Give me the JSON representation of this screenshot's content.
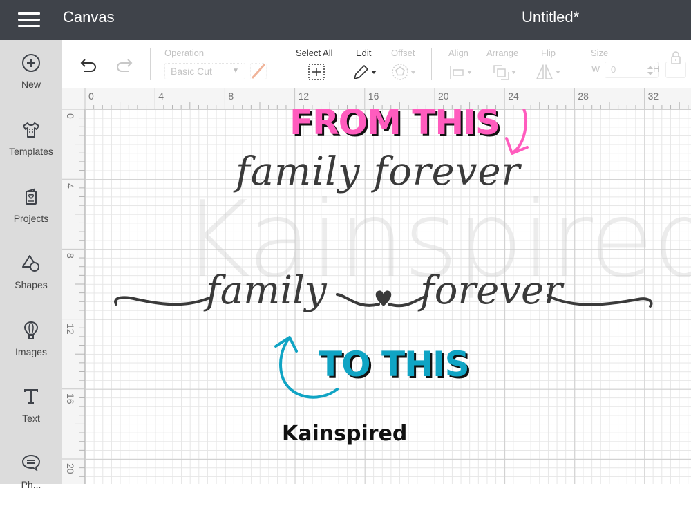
{
  "header": {
    "app_title": "Canvas",
    "document_title": "Untitled*"
  },
  "sidebar": {
    "items": [
      {
        "label": "New",
        "icon": "plus-circle-icon"
      },
      {
        "label": "Templates",
        "icon": "tshirt-icon"
      },
      {
        "label": "Projects",
        "icon": "projects-card-icon"
      },
      {
        "label": "Shapes",
        "icon": "shapes-icon"
      },
      {
        "label": "Images",
        "icon": "hot-air-balloon-icon"
      },
      {
        "label": "Text",
        "icon": "text-t-icon"
      },
      {
        "label": "Ph...",
        "icon": "speech-bubble-icon"
      }
    ]
  },
  "toolbar": {
    "operation_label": "Operation",
    "operation_value": "Basic Cut",
    "select_all_label": "Select All",
    "edit_label": "Edit",
    "offset_label": "Offset",
    "align_label": "Align",
    "arrange_label": "Arrange",
    "flip_label": "Flip",
    "size_label": "Size",
    "width_label": "W",
    "width_value": "0",
    "height_label": "H",
    "linetype_color": "#f0b49a"
  },
  "ruler": {
    "top_ticks": [
      "0",
      "4",
      "8",
      "12",
      "16",
      "20",
      "24",
      "28",
      "32"
    ],
    "left_ticks": [
      "0",
      "4",
      "8",
      "12",
      "16",
      "20"
    ]
  },
  "canvas": {
    "watermark": "Kainspired",
    "from_label": "FROM THIS",
    "to_label": "TO THIS",
    "before_text": "family forever",
    "after_text_left": "family",
    "after_text_right": "forever",
    "credit": "Kainspired",
    "from_color": "#ff5cbe",
    "to_color": "#10a4c4"
  }
}
